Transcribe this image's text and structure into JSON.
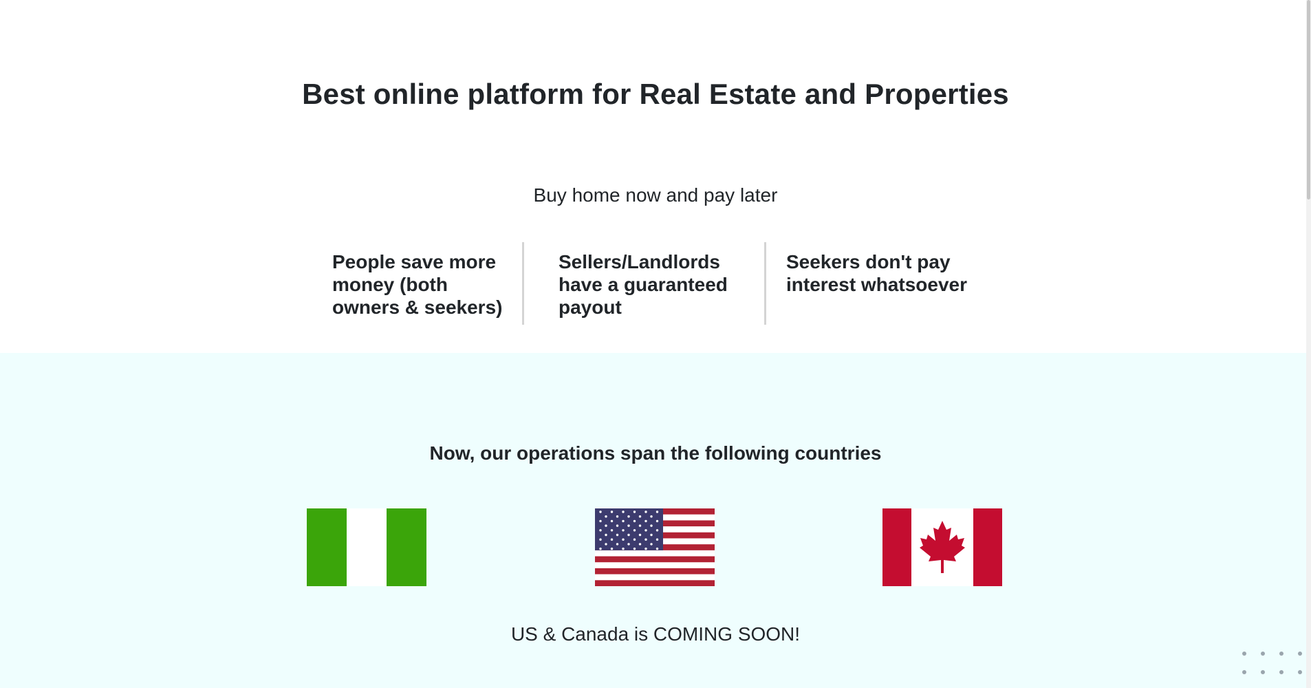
{
  "hero": {
    "title": "Best online platform for Real Estate and Properties",
    "subtitle": "Buy home now and pay later",
    "features": [
      "People save more money (both owners & seekers)",
      "Sellers/Landlords have a guaranteed payout",
      "Seekers don't pay interest whatsoever"
    ]
  },
  "countries": {
    "title": "Now, our operations span the following countries",
    "flags": [
      {
        "icon": "nigeria-flag-icon",
        "colors": [
          "#3ba50a",
          "#ffffff",
          "#3ba50a"
        ]
      },
      {
        "icon": "usa-flag-icon",
        "colors": [
          "#b22234",
          "#ffffff",
          "#3c3b6e"
        ]
      },
      {
        "icon": "canada-flag-icon",
        "colors": [
          "#c40d30",
          "#ffffff",
          "#c40d30"
        ]
      }
    ],
    "note": "US & Canada is COMING SOON!"
  },
  "colors": {
    "section_background": "#effefe",
    "text": "#212529",
    "divider": "#d4d4d4"
  }
}
